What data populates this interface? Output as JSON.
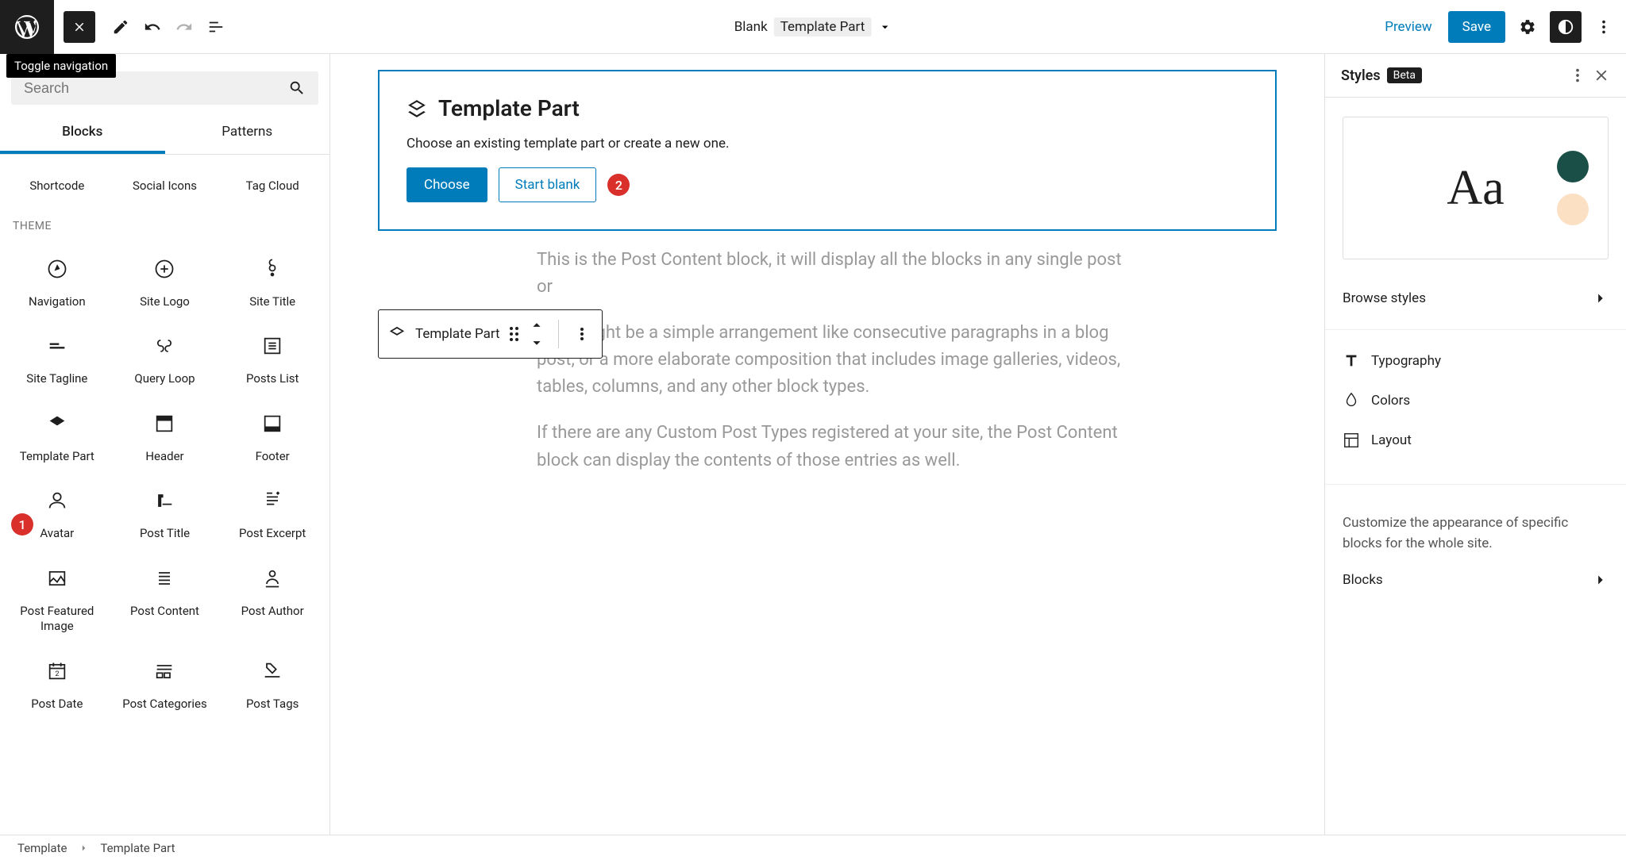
{
  "topbar": {
    "doc_label": "Blank",
    "doc_part": "Template Part",
    "preview": "Preview",
    "save": "Save"
  },
  "tooltip": "Toggle navigation",
  "search": {
    "placeholder": "Search"
  },
  "tabs": {
    "blocks": "Blocks",
    "patterns": "Patterns"
  },
  "leftPanel": {
    "row1": [
      "Shortcode",
      "Social Icons",
      "Tag Cloud"
    ],
    "themeLabel": "THEME",
    "themeBlocks": [
      "Navigation",
      "Site Logo",
      "Site Title",
      "Site Tagline",
      "Query Loop",
      "Posts List",
      "Template Part",
      "Header",
      "Footer",
      "Avatar",
      "Post Title",
      "Post Excerpt",
      "Post Featured Image",
      "Post Content",
      "Post Author",
      "Post Date",
      "Post Categories",
      "Post Tags"
    ]
  },
  "templatePart": {
    "title": "Template Part",
    "desc": "Choose an existing template part or create a new one.",
    "choose": "Choose",
    "startBlank": "Start blank"
  },
  "floatingToolbar": {
    "label": "Template Part"
  },
  "contentText": {
    "p1": "This is the Post Content block, it will display all the blocks in any single post or",
    "p2": "That might be a simple arrangement like consecutive paragraphs in a blog post, or a more elaborate composition that includes image galleries, videos, tables, columns, and any other block types.",
    "p3": "If there are any Custom Post Types registered at your site, the Post Content block can display the contents of those entries as well."
  },
  "rightPanel": {
    "title": "Styles",
    "beta": "Beta",
    "previewText": "Aa",
    "colors": {
      "dot1": "#1a4f47",
      "dot2": "#fbe0c4"
    },
    "browse": "Browse styles",
    "typography": "Typography",
    "colorsLabel": "Colors",
    "layout": "Layout",
    "customize": "Customize the appearance of specific blocks for the whole site.",
    "blocks": "Blocks"
  },
  "annotations": {
    "a1": "1",
    "a2": "2"
  },
  "breadcrumb": {
    "root": "Template",
    "current": "Template Part"
  }
}
